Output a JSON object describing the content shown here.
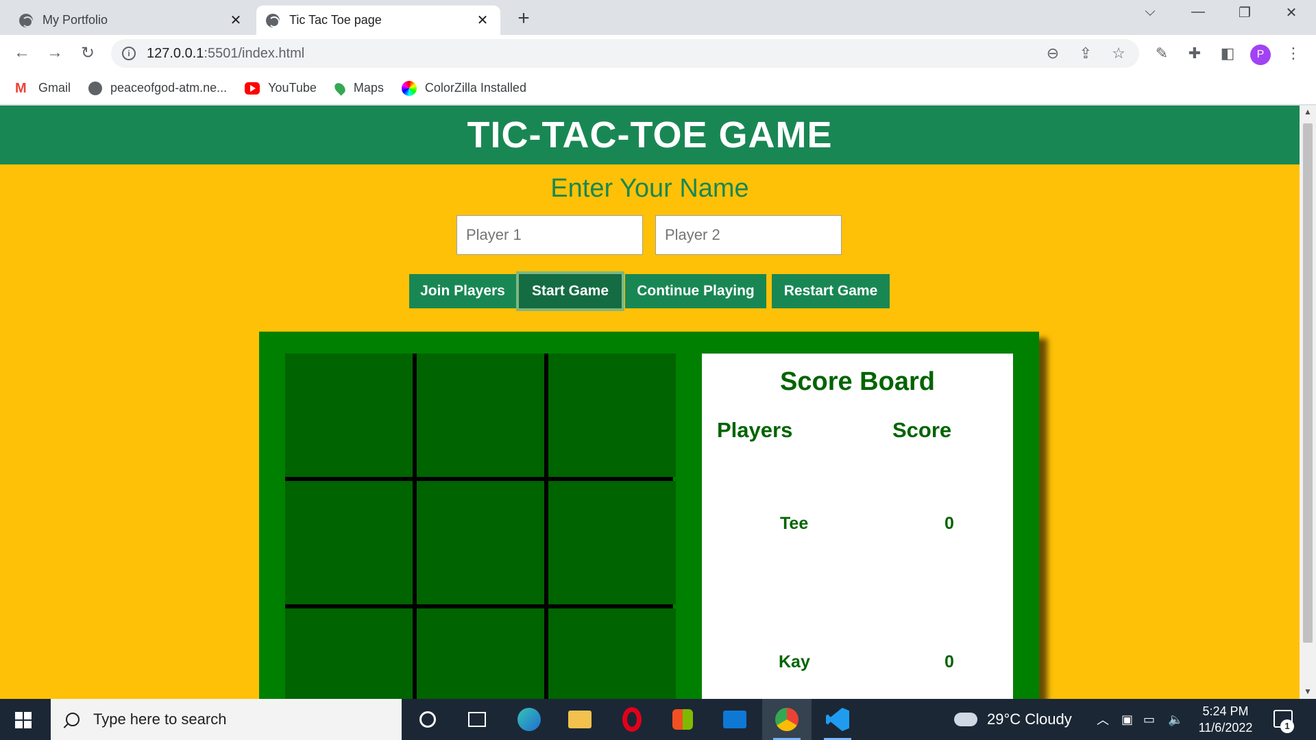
{
  "browser": {
    "tabs": [
      {
        "title": "My Portfolio",
        "active": false
      },
      {
        "title": "Tic Tac Toe page",
        "active": true
      }
    ],
    "url_host": "127.0.0.1",
    "url_path": ":5501/index.html",
    "bookmarks": [
      {
        "label": "Gmail",
        "icon": "gmail-icon"
      },
      {
        "label": "peaceofgod-atm.ne...",
        "icon": "globe-icon"
      },
      {
        "label": "YouTube",
        "icon": "youtube-icon"
      },
      {
        "label": "Maps",
        "icon": "maps-icon"
      },
      {
        "label": "ColorZilla Installed",
        "icon": "colorzilla-icon"
      }
    ],
    "profile_initial": "P"
  },
  "page": {
    "header_title": "TIC-TAC-TOE GAME",
    "subtitle": "Enter Your Name",
    "inputs": {
      "player1_placeholder": "Player 1",
      "player1_value": "",
      "player2_placeholder": "Player 2",
      "player2_value": ""
    },
    "buttons": {
      "join": "Join Players",
      "start": "Start Game",
      "continue": "Continue Playing",
      "restart": "Restart Game"
    },
    "board": {
      "cells": [
        "",
        "",
        "",
        "",
        "",
        "",
        "",
        "",
        ""
      ]
    },
    "scoreboard": {
      "title": "Score Board",
      "col_players": "Players",
      "col_score": "Score",
      "rows": [
        {
          "player": "Tee",
          "score": "0"
        },
        {
          "player": "Kay",
          "score": "0"
        }
      ]
    },
    "colors": {
      "header_green": "#198754",
      "page_yellow": "#ffc107",
      "panel_green": "#008000",
      "cell_green": "#006400"
    }
  },
  "taskbar": {
    "search_placeholder": "Type here to search",
    "weather": "29°C  Cloudy",
    "time": "5:24 PM",
    "date": "11/6/2022",
    "notification_count": "1",
    "pinned_apps": [
      "cortana-icon",
      "task-view-icon",
      "edge-icon",
      "file-explorer-icon",
      "opera-icon",
      "store-icon",
      "mail-icon",
      "chrome-icon",
      "vscode-icon"
    ]
  }
}
